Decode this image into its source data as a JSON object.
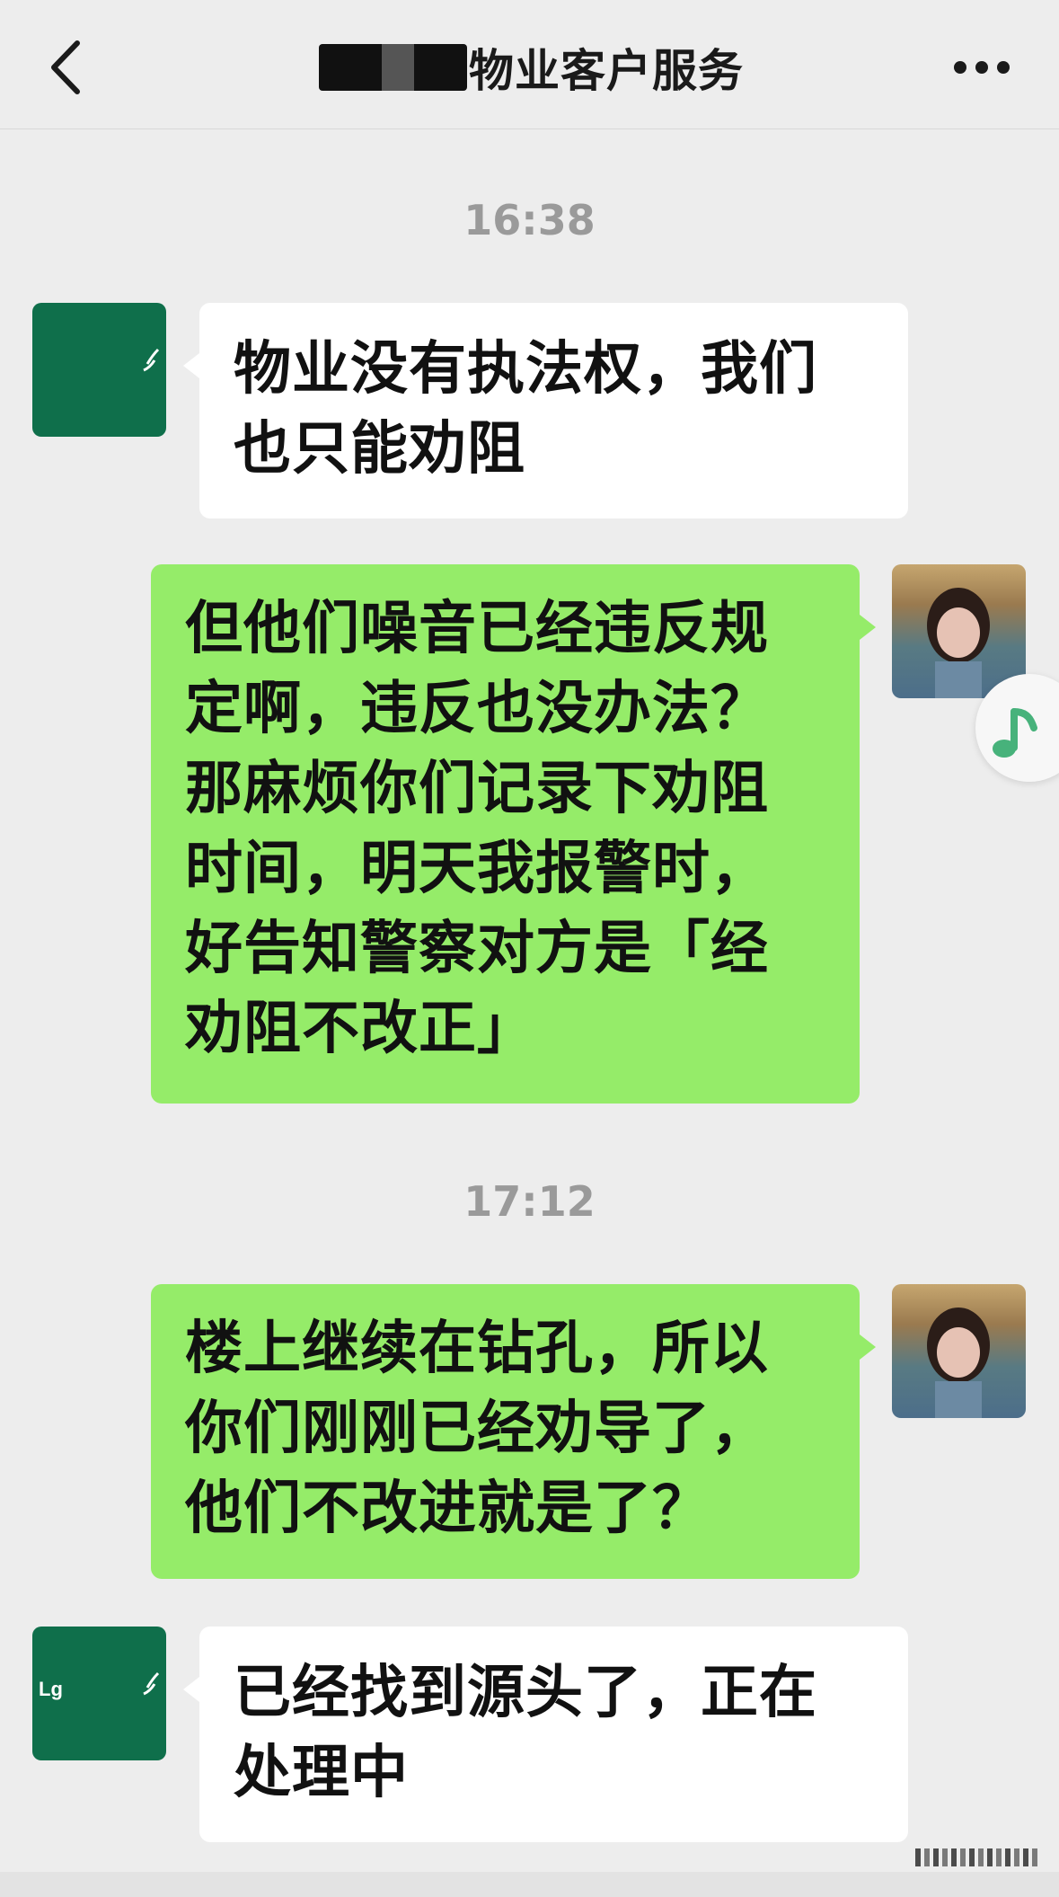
{
  "header": {
    "title": "物业客户服务"
  },
  "icons": {
    "back": "chevron-left-icon",
    "more": "more-dots-icon",
    "music": "music-note-icon"
  },
  "colors": {
    "background": "#ededed",
    "incoming_bubble": "#ffffff",
    "outgoing_bubble": "#95ec69",
    "official_avatar": "#0f6f4b",
    "timestamp": "#9a9a9a"
  },
  "messages": [
    {
      "time": "16:38"
    },
    {
      "lines": [
        "物业没有执法权，我们",
        "也只能劝阻"
      ]
    },
    {
      "lines": [
        "但他们噪音已经违反规",
        "定啊，违反也没办法？",
        "那麻烦你们记录下劝阻",
        "时间，明天我报警时，",
        "好告知警察对方是「经",
        "劝阻不改正」"
      ]
    },
    {
      "time": "17:12"
    },
    {
      "lines": [
        "楼上继续在钻孔，所以",
        "你们刚刚已经劝导了，",
        "他们不改进就是了？"
      ]
    },
    {
      "lines": [
        "已经找到源头了，正在",
        "处理中"
      ]
    }
  ],
  "avatar_text": {
    "official_second": "Lg"
  }
}
